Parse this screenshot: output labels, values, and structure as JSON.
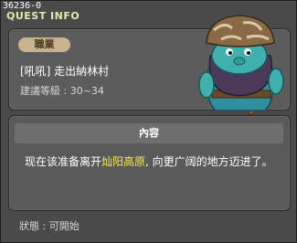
{
  "window": {
    "quest_id": "36236-0",
    "title": "QUEST INFO",
    "close_icon": "close-icon"
  },
  "header": {
    "job_label": "職業",
    "quest_name": "[吼吼] 走出納林村",
    "level_label": "建議等級 : 30~34",
    "npc_image": "npc-portrait"
  },
  "content": {
    "heading": "內容",
    "text_before": "现在该准备离开",
    "text_highlight": "灿阳高原",
    "text_after": ", 向更广阔的地方迈进了。"
  },
  "footer": {
    "status": "狀態 : 可開始"
  },
  "colors": {
    "highlight": "#ffe94a",
    "title": "#e8e8a8",
    "job_pill": "#c9b48f"
  }
}
